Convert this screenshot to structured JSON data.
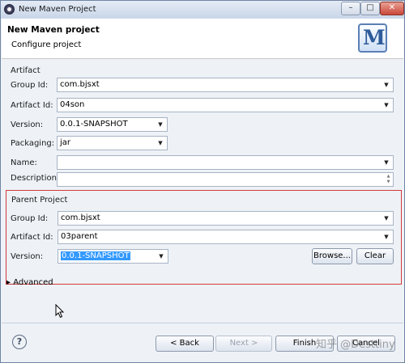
{
  "window": {
    "title": "New Maven Project",
    "min": "–",
    "max": "□",
    "close": "✕"
  },
  "header": {
    "title": "New Maven project",
    "subtitle": "Configure project",
    "logo_letter": "M"
  },
  "artifact": {
    "group_label": "Artifact",
    "group_id": {
      "label": "Group Id:",
      "value": "com.bjsxt"
    },
    "artifact_id": {
      "label": "Artifact Id:",
      "value": "04son"
    },
    "version": {
      "label": "Version:",
      "value": "0.0.1-SNAPSHOT"
    },
    "packaging": {
      "label": "Packaging:",
      "value": "jar"
    },
    "name": {
      "label": "Name:",
      "value": ""
    },
    "description": {
      "label": "Description:",
      "value": ""
    }
  },
  "parent": {
    "group_label": "Parent Project",
    "group_id": {
      "label": "Group Id:",
      "value": "com.bjsxt"
    },
    "artifact_id": {
      "label": "Artifact Id:",
      "value": "03parent"
    },
    "version": {
      "label": "Version:",
      "value": "0.0.1-SNAPSHOT"
    },
    "browse_label": "Browse...",
    "clear_label": "Clear"
  },
  "advanced": {
    "label": "Advanced"
  },
  "footer": {
    "help_symbol": "?",
    "back_label": "< Back",
    "next_label": "Next >",
    "finish_label": "Finish",
    "cancel_label": "Cancel",
    "watermark": "知乎 @Desttiny"
  },
  "icons": {
    "dropdown": "▼",
    "spin_up": "▲",
    "spin_down": "▼",
    "expand": "▸"
  }
}
